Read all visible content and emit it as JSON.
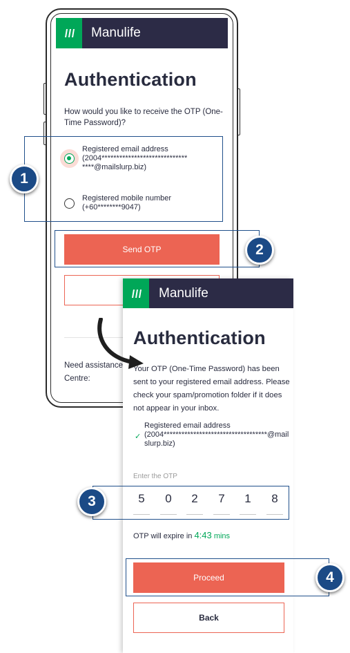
{
  "brand": {
    "name": "Manulife"
  },
  "colors": {
    "brand_green": "#00a758",
    "header_navy": "#2c2b46",
    "action_red": "#ec6453",
    "callout_blue": "#1b4a86"
  },
  "screen1": {
    "title": "Authentication",
    "question": "How would you like to receive the OTP (One-Time Password)?",
    "options": [
      {
        "label": "Registered email address",
        "line2": "(2004*****************************",
        "line3": "****@mailslurp.biz)",
        "selected": true
      },
      {
        "label": "Registered mobile number",
        "line2": "(+60********9047)",
        "selected": false
      }
    ],
    "send_otp_label": "Send OTP",
    "assist_line1": "Need assistance",
    "assist_line2": "Centre:"
  },
  "screen2": {
    "title": "Authentication",
    "info": "Your OTP (One-Time Password) has been sent to your registered email address. Please check your spam/promotion folder if it does not appear in your inbox.",
    "registered_label": "Registered email address",
    "registered_value": "(2004***********************************@mailslurp.biz)",
    "enter_otp_label": "Enter the OTP",
    "otp_digits": [
      "5",
      "0",
      "2",
      "7",
      "1",
      "8"
    ],
    "expire_prefix": "OTP will expire in",
    "expire_time": "4:43",
    "expire_unit": "mins",
    "proceed_label": "Proceed",
    "back_label": "Back"
  },
  "callouts": {
    "step1": "1",
    "step2": "2",
    "step3": "3",
    "step4": "4"
  },
  "icons": {
    "logo": "manulife-logo-icon",
    "check": "checkmark-icon",
    "arrow": "curved-arrow-icon"
  }
}
